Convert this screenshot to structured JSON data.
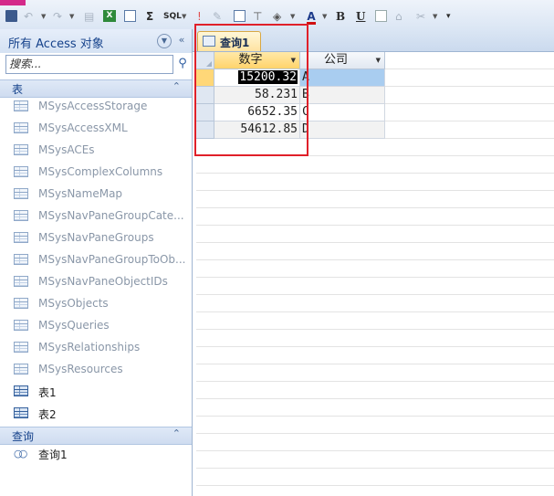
{
  "toolbar": {
    "sum_label": "Σ",
    "sql_label": "SQL",
    "excel_label": "X",
    "exclaim_label": "!",
    "font_color_label": "A",
    "bold_label": "B",
    "underline_label": "U"
  },
  "nav": {
    "title": "所有 Access 对象",
    "search_placeholder": "搜索...",
    "tables_group": "表",
    "queries_group": "查询",
    "tables": [
      {
        "label": "MSysAccessStorage"
      },
      {
        "label": "MSysAccessXML"
      },
      {
        "label": "MSysACEs"
      },
      {
        "label": "MSysComplexColumns"
      },
      {
        "label": "MSysNameMap"
      },
      {
        "label": "MSysNavPaneGroupCate..."
      },
      {
        "label": "MSysNavPaneGroups"
      },
      {
        "label": "MSysNavPaneGroupToOb..."
      },
      {
        "label": "MSysNavPaneObjectIDs"
      },
      {
        "label": "MSysObjects"
      },
      {
        "label": "MSysQueries"
      },
      {
        "label": "MSysRelationships"
      },
      {
        "label": "MSysResources"
      },
      {
        "label": "表1"
      },
      {
        "label": "表2"
      }
    ],
    "queries": [
      {
        "label": "查询1"
      }
    ]
  },
  "document": {
    "tab_label": "查询1",
    "columns": [
      "数字",
      "公司"
    ],
    "rows": [
      {
        "number": "15200.32",
        "company": "A"
      },
      {
        "number": "58.231",
        "company": "B"
      },
      {
        "number": "6652.35",
        "company": "C"
      },
      {
        "number": "54612.85",
        "company": "D"
      }
    ]
  },
  "colors": {
    "annotation_box": "#e0202a",
    "active_tab": "#ffe3a1",
    "selection_highlight": "#a9cdf0"
  }
}
